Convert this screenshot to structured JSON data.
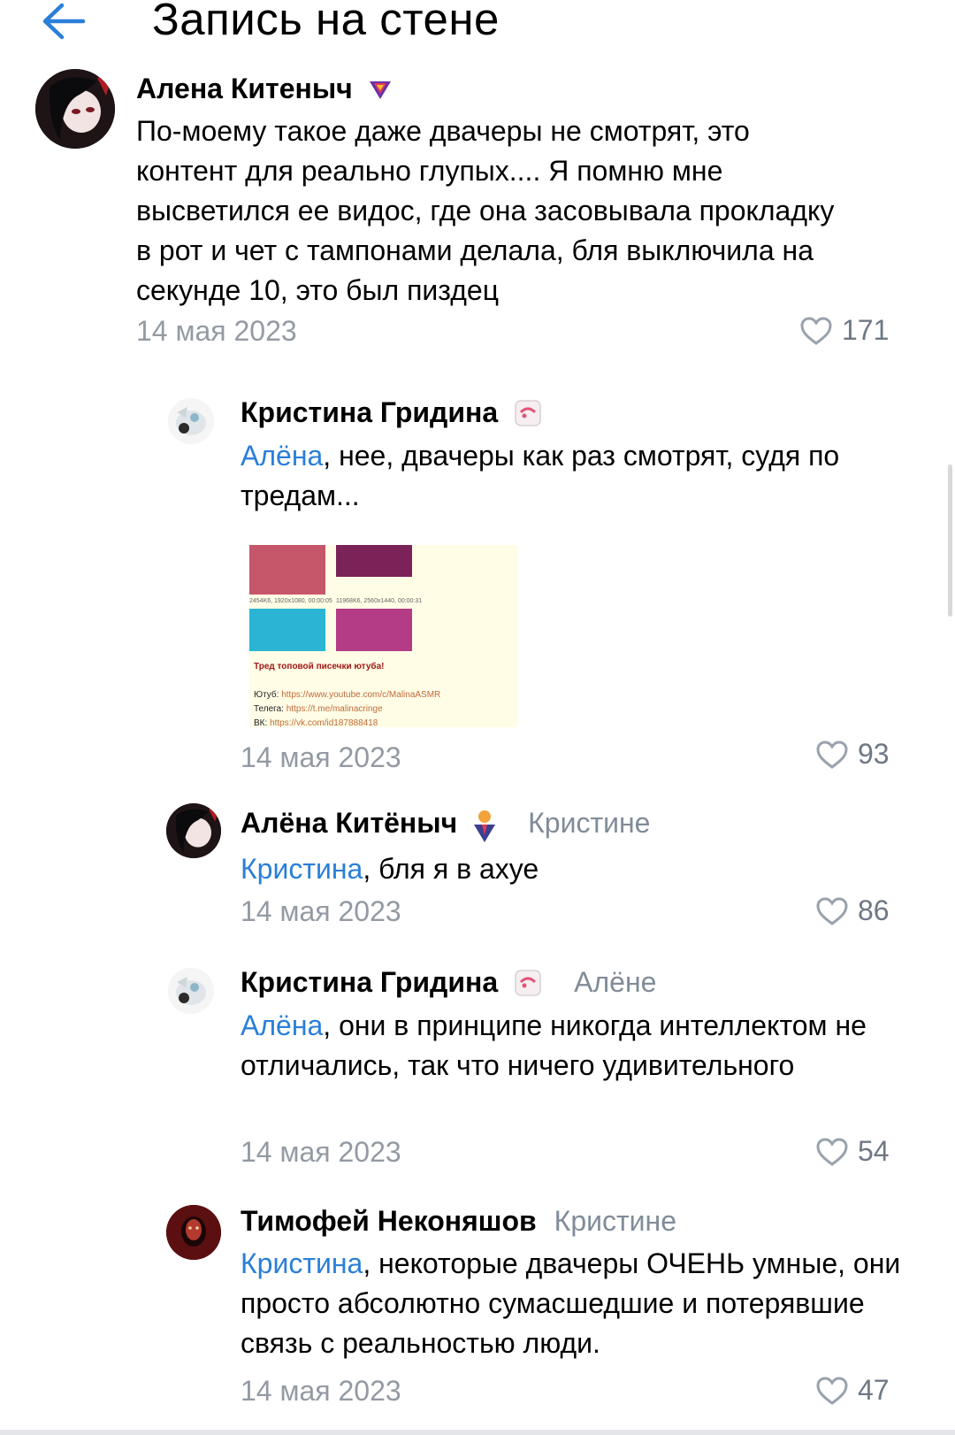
{
  "header": {
    "title": "Запись на стене"
  },
  "comments": [
    {
      "author": "Алена Китеныч",
      "text": "По-моему такое даже двачеры не смотрят, это контент для реально глупых.... Я помню мне высветился ее видос, где она засовывала прокладку в рот и чет с тампонами делала, бля выключила на секунде 10, это был пиздец",
      "date": "14 мая 2023",
      "likes": "171"
    },
    {
      "author": "Кристина Гридина",
      "mention": "Алёна",
      "text": ", нее, двачеры как раз смотрят, судя по тредам...",
      "date": "14 мая 2023",
      "likes": "93",
      "attachment": {
        "caption1": "2454K6, 1920x1080, 00:00:05",
        "caption2": "11968K6, 2560x1440, 00:00:31",
        "thread_title": "Тред топовой писечки ютуба!",
        "line1_label": "Ютуб:",
        "line1_link": "https://www.youtube.com/c/MalinaASMR",
        "line2_label": "Телега:",
        "line2_link": "https://t.me/malinacringe",
        "line3_label": "ВК:",
        "line3_link": "https://vk.com/id187888418"
      }
    },
    {
      "author": "Алёна Китёныч",
      "reply_to": "Кристине",
      "mention": "Кристина",
      "text": ", бля я в ахуе",
      "date": "14 мая 2023",
      "likes": "86"
    },
    {
      "author": "Кристина Гридина",
      "reply_to": "Алёне",
      "mention": "Алёна",
      "text": ", они в принципе никогда интеллектом не отличались, так что ничего удивительного",
      "date": "14 мая 2023",
      "likes": "54"
    },
    {
      "author": "Тимофей Неконяшов",
      "reply_to": "Кристине",
      "mention": "Кристина",
      "text": ", некоторые двачеры ОЧЕНЬ умные, они просто абсолютно сумасшедшие и потерявшие связь с реальностью люди.",
      "date": "14 мая 2023",
      "likes": "47"
    }
  ],
  "colors": {
    "accent": "#2a7fd8",
    "secondary_text": "#818c99",
    "like_icon": "#99a2ad"
  },
  "icons": [
    "back-arrow-icon",
    "heart-icon",
    "vip-badge-icon",
    "sticker-badge-icon"
  ]
}
